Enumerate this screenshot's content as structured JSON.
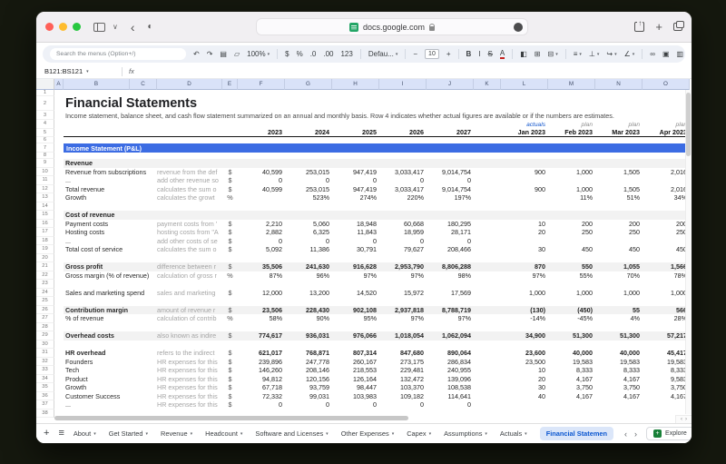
{
  "browser": {
    "url": "docs.google.com"
  },
  "toolbar": {
    "search_placeholder": "Search the menus (Option+/)",
    "items": [
      {
        "type": "icon",
        "name": "undo-icon",
        "glyph": "↶"
      },
      {
        "type": "icon",
        "name": "redo-icon",
        "glyph": "↷"
      },
      {
        "type": "icon",
        "name": "print-icon",
        "glyph": "▤"
      },
      {
        "type": "icon",
        "name": "paint-format-icon",
        "glyph": "▱"
      },
      {
        "type": "select",
        "name": "zoom-select",
        "label": "100%"
      },
      {
        "type": "div"
      },
      {
        "type": "icon",
        "name": "format-currency-icon",
        "glyph": "$"
      },
      {
        "type": "icon",
        "name": "format-percent-icon",
        "glyph": "%"
      },
      {
        "type": "icon",
        "name": "decrease-decimal-icon",
        "glyph": ".0"
      },
      {
        "type": "icon",
        "name": "increase-decimal-icon",
        "glyph": ".00"
      },
      {
        "type": "icon",
        "name": "more-formats-icon",
        "glyph": "123"
      },
      {
        "type": "div"
      },
      {
        "type": "select",
        "name": "font-select",
        "label": "Defau..."
      },
      {
        "type": "div"
      },
      {
        "type": "icon",
        "name": "decrease-font-size-icon",
        "glyph": "−"
      },
      {
        "type": "box",
        "name": "font-size-input",
        "label": "10"
      },
      {
        "type": "icon",
        "name": "increase-font-size-icon",
        "glyph": "+"
      },
      {
        "type": "div"
      },
      {
        "type": "icon",
        "name": "bold-icon",
        "glyph": "B"
      },
      {
        "type": "icon",
        "name": "italic-icon",
        "glyph": "I"
      },
      {
        "type": "icon",
        "name": "strikethrough-icon",
        "glyph": "S"
      },
      {
        "type": "icon",
        "name": "text-color-icon",
        "glyph": "A"
      },
      {
        "type": "div"
      },
      {
        "type": "icon",
        "name": "fill-color-icon",
        "glyph": "◧"
      },
      {
        "type": "icon",
        "name": "borders-icon",
        "glyph": "⊞"
      },
      {
        "type": "select",
        "name": "merge-cells-icon",
        "label": "⊟"
      },
      {
        "type": "div"
      },
      {
        "type": "select",
        "name": "horizontal-align-icon",
        "label": "≡"
      },
      {
        "type": "select",
        "name": "vertical-align-icon",
        "label": "⊥"
      },
      {
        "type": "select",
        "name": "text-wrap-icon",
        "label": "↪"
      },
      {
        "type": "select",
        "name": "text-rotation-icon",
        "label": "∠"
      },
      {
        "type": "div"
      },
      {
        "type": "icon",
        "name": "insert-link-icon",
        "glyph": "∞"
      },
      {
        "type": "icon",
        "name": "insert-comment-icon",
        "glyph": "▣"
      },
      {
        "type": "icon",
        "name": "insert-chart-icon",
        "glyph": "▥"
      },
      {
        "type": "select",
        "name": "create-filter-icon",
        "label": "▽"
      },
      {
        "type": "icon",
        "name": "functions-icon",
        "glyph": "Σ"
      }
    ],
    "more_glyph": "⌄"
  },
  "formula_bar": {
    "name_box": "B121:BS121",
    "fx_label": "fx",
    "caret": "▾"
  },
  "grid": {
    "columns": [
      "",
      "A",
      "B",
      "C",
      "D",
      "E",
      "F",
      "G",
      "H",
      "I",
      "J",
      "K",
      "L",
      "M",
      "N",
      "O"
    ],
    "title": "Financial Statements",
    "subtitle": "Income statement, balance sheet, and cash flow statement summarized on an annual and monthly basis. Row 4 indicates whether actual figures are available or if the numbers are estimates.",
    "banner": "Income Statement (P&L)",
    "status_labels": [
      "actuals",
      "plan",
      "plan",
      "plan"
    ],
    "rows": [
      {
        "n": 1,
        "t": "blank"
      },
      {
        "n": 2,
        "t": "title"
      },
      {
        "n": 3,
        "t": "subtitle"
      },
      {
        "n": 4,
        "t": "status"
      },
      {
        "n": 5,
        "t": "periods",
        "vals": [
          "2023",
          "2024",
          "2025",
          "2026",
          "2027",
          "Jan 2023",
          "Feb 2023",
          "Mar 2023",
          "Apr 2023"
        ]
      },
      {
        "n": 6,
        "t": "blank"
      },
      {
        "n": 7,
        "t": "banner"
      },
      {
        "n": 8,
        "t": "blank"
      },
      {
        "n": 9,
        "t": "section",
        "label": "Revenue"
      },
      {
        "n": 10,
        "t": "data",
        "label": "Revenue from subscriptions",
        "desc": "revenue from the def",
        "unit": "$",
        "vals": [
          "40,599",
          "253,015",
          "947,419",
          "3,033,417",
          "9,014,754",
          "900",
          "1,000",
          "1,505",
          "2,016"
        ]
      },
      {
        "n": 11,
        "t": "data",
        "label": "...",
        "desc": "add other revenue so",
        "unit": "$",
        "vals": [
          "0",
          "0",
          "0",
          "0",
          "0",
          "",
          "",
          "",
          ""
        ]
      },
      {
        "n": 12,
        "t": "data",
        "label": "Total revenue",
        "desc": "calculates the sum o",
        "unit": "$",
        "vals": [
          "40,599",
          "253,015",
          "947,419",
          "3,033,417",
          "9,014,754",
          "900",
          "1,000",
          "1,505",
          "2,016"
        ]
      },
      {
        "n": 13,
        "t": "data",
        "label": "Growth",
        "desc": "calculates the growt",
        "unit": "%",
        "vals": [
          "",
          "523%",
          "274%",
          "220%",
          "197%",
          "",
          "11%",
          "51%",
          "34%"
        ]
      },
      {
        "n": 14,
        "t": "blank"
      },
      {
        "n": 15,
        "t": "section",
        "label": "Cost of revenue"
      },
      {
        "n": 16,
        "t": "data",
        "label": "Payment costs",
        "desc": "payment costs from '",
        "unit": "$",
        "vals": [
          "2,210",
          "5,060",
          "18,948",
          "60,668",
          "180,295",
          "10",
          "200",
          "200",
          "200"
        ]
      },
      {
        "n": 17,
        "t": "data",
        "label": "Hosting costs",
        "desc": "hosting costs from \"A",
        "unit": "$",
        "vals": [
          "2,882",
          "6,325",
          "11,843",
          "18,959",
          "28,171",
          "20",
          "250",
          "250",
          "250"
        ]
      },
      {
        "n": 18,
        "t": "data",
        "label": "...",
        "desc": "add other costs of se",
        "unit": "$",
        "vals": [
          "0",
          "0",
          "0",
          "0",
          "0",
          "",
          "",
          "",
          ""
        ]
      },
      {
        "n": 19,
        "t": "data",
        "label": "Total cost of service",
        "desc": "calculates the sum o",
        "unit": "$",
        "vals": [
          "5,092",
          "11,386",
          "30,791",
          "79,627",
          "208,466",
          "30",
          "450",
          "450",
          "450"
        ]
      },
      {
        "n": 20,
        "t": "blank"
      },
      {
        "n": 21,
        "t": "band",
        "label": "Gross profit",
        "desc": "difference between r",
        "unit": "$",
        "vals": [
          "35,506",
          "241,630",
          "916,628",
          "2,953,790",
          "8,806,288",
          "870",
          "550",
          "1,055",
          "1,566"
        ]
      },
      {
        "n": 22,
        "t": "data",
        "label": "Gross margin (% of revenue)",
        "desc": "calculation of gross r",
        "unit": "%",
        "vals": [
          "87%",
          "96%",
          "97%",
          "97%",
          "98%",
          "97%",
          "55%",
          "70%",
          "78%"
        ]
      },
      {
        "n": 23,
        "t": "blank"
      },
      {
        "n": 24,
        "t": "data",
        "label": "Sales and marketing spend",
        "desc": "sales and marketing",
        "unit": "$",
        "vals": [
          "12,000",
          "13,200",
          "14,520",
          "15,972",
          "17,569",
          "1,000",
          "1,000",
          "1,000",
          "1,000"
        ]
      },
      {
        "n": 25,
        "t": "blank"
      },
      {
        "n": 26,
        "t": "band",
        "label": "Contribution margin",
        "desc": "amount of revenue r",
        "unit": "$",
        "vals": [
          "23,506",
          "228,430",
          "902,108",
          "2,937,818",
          "8,788,719",
          "(130)",
          "(450)",
          "55",
          "566"
        ]
      },
      {
        "n": 27,
        "t": "data",
        "label": "% of revenue",
        "desc": "calculation of contrib",
        "unit": "%",
        "vals": [
          "58%",
          "90%",
          "95%",
          "97%",
          "97%",
          "-14%",
          "-45%",
          "4%",
          "28%"
        ]
      },
      {
        "n": 28,
        "t": "blank"
      },
      {
        "n": 29,
        "t": "band",
        "label": "Overhead costs",
        "desc": "also known as indire",
        "unit": "$",
        "vals": [
          "774,617",
          "936,031",
          "976,066",
          "1,018,054",
          "1,062,094",
          "34,900",
          "51,300",
          "51,300",
          "57,217"
        ]
      },
      {
        "n": 30,
        "t": "blank"
      },
      {
        "n": 31,
        "t": "bold",
        "label": "HR overhead",
        "desc": "refers to the indirect",
        "unit": "$",
        "vals": [
          "621,017",
          "768,871",
          "807,314",
          "847,680",
          "890,064",
          "23,600",
          "40,000",
          "40,000",
          "45,417"
        ]
      },
      {
        "n": 32,
        "t": "data",
        "label": "Founders",
        "desc": "HR expenses for this",
        "unit": "$",
        "vals": [
          "239,896",
          "247,778",
          "260,167",
          "273,175",
          "286,834",
          "23,500",
          "19,583",
          "19,583",
          "19,583"
        ]
      },
      {
        "n": 33,
        "t": "data",
        "label": "Tech",
        "desc": "HR expenses for this",
        "unit": "$",
        "vals": [
          "146,260",
          "208,146",
          "218,553",
          "229,481",
          "240,955",
          "10",
          "8,333",
          "8,333",
          "8,333"
        ]
      },
      {
        "n": 34,
        "t": "data",
        "label": "Product",
        "desc": "HR expenses for this",
        "unit": "$",
        "vals": [
          "94,812",
          "120,156",
          "126,164",
          "132,472",
          "139,096",
          "20",
          "4,167",
          "4,167",
          "9,583"
        ]
      },
      {
        "n": 35,
        "t": "data",
        "label": "Growth",
        "desc": "HR expenses for this",
        "unit": "$",
        "vals": [
          "67,718",
          "93,759",
          "98,447",
          "103,370",
          "108,538",
          "30",
          "3,750",
          "3,750",
          "3,750"
        ]
      },
      {
        "n": 36,
        "t": "data",
        "label": "Customer Success",
        "desc": "HR expenses for this",
        "unit": "$",
        "vals": [
          "72,332",
          "99,031",
          "103,983",
          "109,182",
          "114,641",
          "40",
          "4,167",
          "4,167",
          "4,167"
        ]
      },
      {
        "n": 37,
        "t": "data",
        "label": "...",
        "desc": "HR expenses for this",
        "unit": "$",
        "vals": [
          "0",
          "0",
          "0",
          "0",
          "0",
          "",
          "",
          "",
          ""
        ]
      },
      {
        "n": 38,
        "t": "blank"
      }
    ]
  },
  "tabbar": {
    "tabs": [
      {
        "label": "About"
      },
      {
        "label": "Get Started"
      },
      {
        "label": "Revenue"
      },
      {
        "label": "Headcount"
      },
      {
        "label": "Software and Licenses"
      },
      {
        "label": "Other Expenses"
      },
      {
        "label": "Capex"
      },
      {
        "label": "Assumptions"
      },
      {
        "label": "Actuals"
      },
      {
        "label": "Financial Statemen",
        "active": true
      }
    ],
    "explore_label": "Explore"
  },
  "colors": {
    "banner_blue": "#3c6ce3",
    "band_gray": "#f2f2f2",
    "selected_header": "#d9e2f8",
    "accent_blue": "#0b57d0",
    "actuals_link": "#1155cc"
  }
}
